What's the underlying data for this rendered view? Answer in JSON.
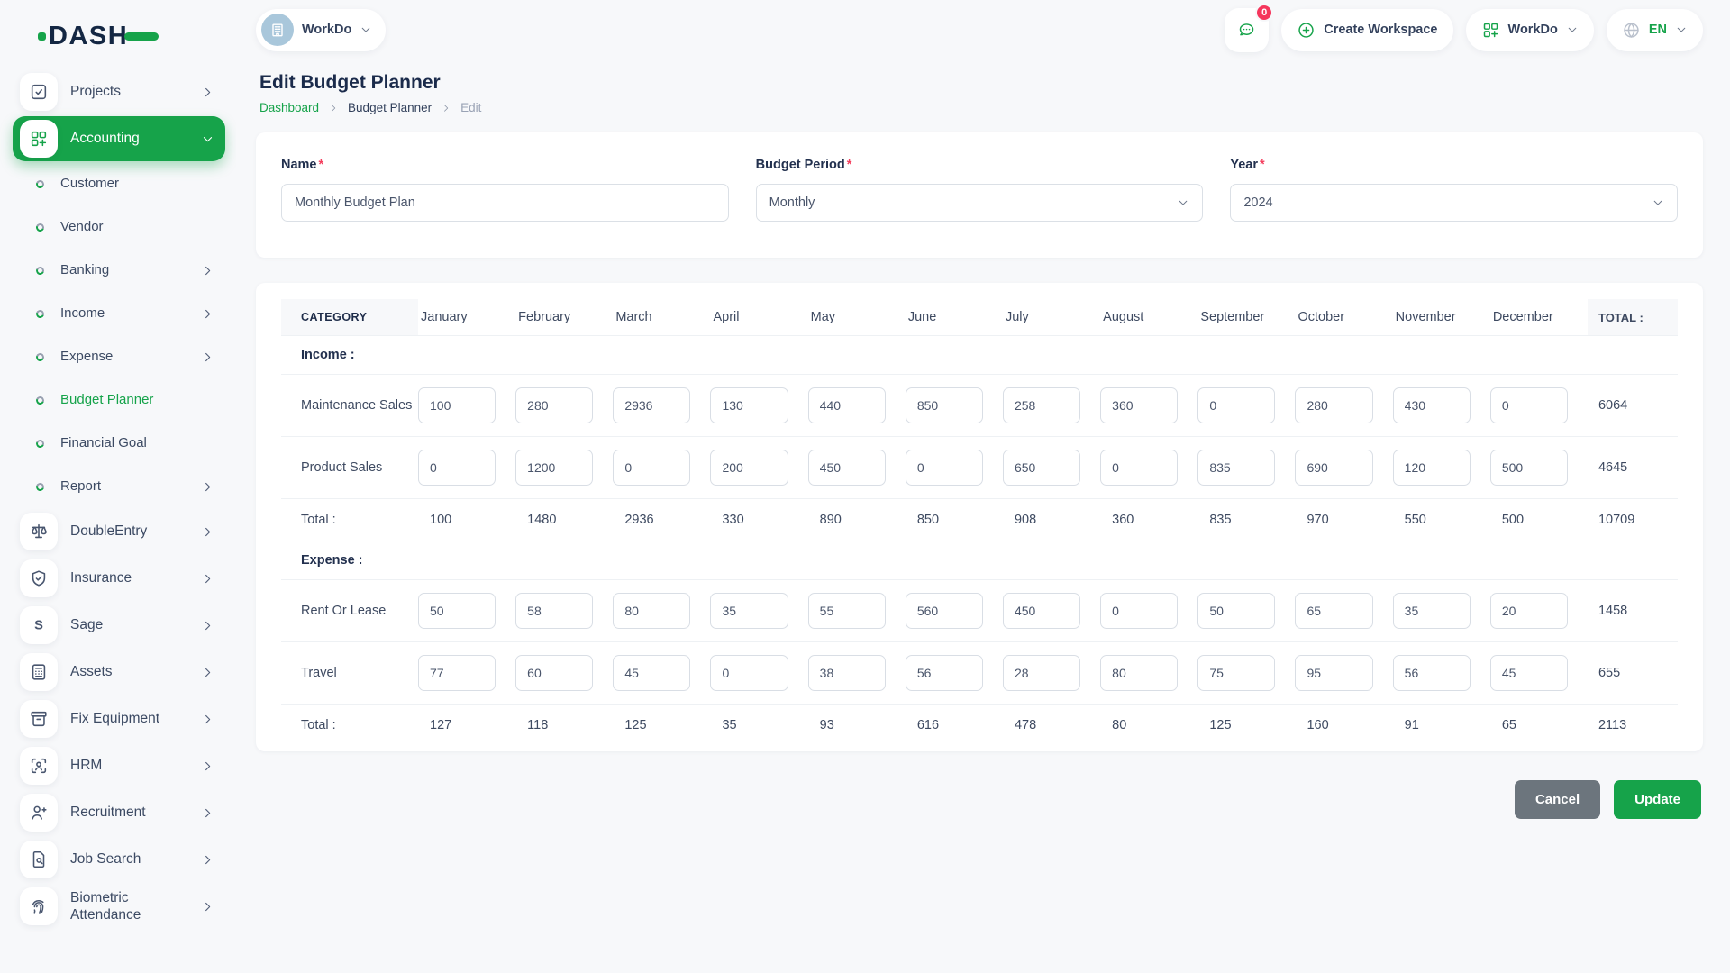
{
  "colors": {
    "accent": "#16a34a",
    "badge": "#f5365c",
    "cancel_button": "#6c757d"
  },
  "brand": {
    "logo_text": "DASH"
  },
  "topbar": {
    "workspace": {
      "label": "WorkDo"
    },
    "messages": {
      "badge": "0"
    },
    "create_workspace": {
      "label": "Create Workspace"
    },
    "app_menu": {
      "label": "WorkDo"
    },
    "language": {
      "label": "EN"
    }
  },
  "sidebar": {
    "items": [
      {
        "label": "Projects",
        "type": "top",
        "icon": "check-square-icon",
        "chevron": "right"
      },
      {
        "label": "Accounting",
        "type": "top",
        "icon": "grid-plus-icon",
        "chevron": "down",
        "active": true
      },
      {
        "label": "Customer",
        "type": "sub"
      },
      {
        "label": "Vendor",
        "type": "sub"
      },
      {
        "label": "Banking",
        "type": "sub",
        "chevron": "right"
      },
      {
        "label": "Income",
        "type": "sub",
        "chevron": "right"
      },
      {
        "label": "Expense",
        "type": "sub",
        "chevron": "right"
      },
      {
        "label": "Budget Planner",
        "type": "sub",
        "active": true
      },
      {
        "label": "Financial Goal",
        "type": "sub"
      },
      {
        "label": "Report",
        "type": "sub",
        "chevron": "right"
      },
      {
        "label": "DoubleEntry",
        "type": "top",
        "icon": "scales-icon",
        "chevron": "right"
      },
      {
        "label": "Insurance",
        "type": "top",
        "icon": "shield-check-icon",
        "chevron": "right"
      },
      {
        "label": "Sage",
        "type": "top",
        "icon": "letter-s-icon",
        "chevron": "right"
      },
      {
        "label": "Assets",
        "type": "top",
        "icon": "calculator-icon",
        "chevron": "right"
      },
      {
        "label": "Fix Equipment",
        "type": "top",
        "icon": "archive-icon",
        "chevron": "right"
      },
      {
        "label": "HRM",
        "type": "top",
        "icon": "user-scan-icon",
        "chevron": "right"
      },
      {
        "label": "Recruitment",
        "type": "top",
        "icon": "user-plus-icon",
        "chevron": "right"
      },
      {
        "label": "Job Search",
        "type": "top",
        "icon": "file-search-icon",
        "chevron": "right"
      },
      {
        "label": "Biometric Attendance",
        "type": "top",
        "icon": "fingerprint-icon",
        "chevron": "right"
      }
    ]
  },
  "page": {
    "title": "Edit Budget Planner",
    "breadcrumb_labels": [
      "Dashboard",
      "Budget Planner",
      "Edit"
    ],
    "required_marker": "*"
  },
  "form": {
    "name": {
      "label": "Name",
      "value": "Monthly Budget Plan"
    },
    "budget_period": {
      "label": "Budget Period",
      "value": "Monthly"
    },
    "year": {
      "label": "Year",
      "value": "2024"
    }
  },
  "budget_table": {
    "category_header": "CATEGORY",
    "total_header": "TOTAL :",
    "months": [
      "January",
      "February",
      "March",
      "April",
      "May",
      "June",
      "July",
      "August",
      "September",
      "October",
      "November",
      "December"
    ],
    "sections": [
      {
        "label": "Income :",
        "rows": [
          {
            "name": "Maintenance Sales",
            "values": [
              "100",
              "280",
              "2936",
              "130",
              "440",
              "850",
              "258",
              "360",
              "0",
              "280",
              "430",
              "0"
            ],
            "total": "6064"
          },
          {
            "name": "Product Sales",
            "values": [
              "0",
              "1200",
              "0",
              "200",
              "450",
              "0",
              "650",
              "0",
              "835",
              "690",
              "120",
              "500"
            ],
            "total": "4645"
          }
        ],
        "total_row": {
          "label": "Total :",
          "values": [
            "100",
            "1480",
            "2936",
            "330",
            "890",
            "850",
            "908",
            "360",
            "835",
            "970",
            "550",
            "500"
          ],
          "total": "10709"
        }
      },
      {
        "label": "Expense :",
        "rows": [
          {
            "name": "Rent Or Lease",
            "values": [
              "50",
              "58",
              "80",
              "35",
              "55",
              "560",
              "450",
              "0",
              "50",
              "65",
              "35",
              "20"
            ],
            "total": "1458"
          },
          {
            "name": "Travel",
            "values": [
              "77",
              "60",
              "45",
              "0",
              "38",
              "56",
              "28",
              "80",
              "75",
              "95",
              "56",
              "45"
            ],
            "total": "655"
          }
        ],
        "total_row": {
          "label": "Total :",
          "values": [
            "127",
            "118",
            "125",
            "35",
            "93",
            "616",
            "478",
            "80",
            "125",
            "160",
            "91",
            "65"
          ],
          "total": "2113"
        }
      }
    ]
  },
  "actions": {
    "cancel": "Cancel",
    "update": "Update"
  }
}
